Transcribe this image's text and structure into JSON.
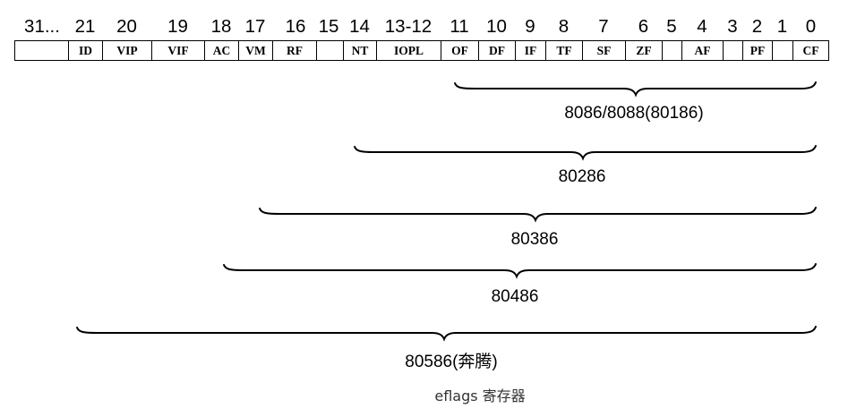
{
  "header_bits": [
    {
      "label": "31..."
    },
    {
      "label": "21"
    },
    {
      "label": "20"
    },
    {
      "label": "19"
    },
    {
      "label": "18"
    },
    {
      "label": "17"
    },
    {
      "label": "16"
    },
    {
      "label": "15"
    },
    {
      "label": "14"
    },
    {
      "label": "13-12"
    },
    {
      "label": "11"
    },
    {
      "label": "10"
    },
    {
      "label": "9"
    },
    {
      "label": "8"
    },
    {
      "label": "7"
    },
    {
      "label": "6"
    },
    {
      "label": "5"
    },
    {
      "label": "4"
    },
    {
      "label": "3"
    },
    {
      "label": "2"
    },
    {
      "label": "1"
    },
    {
      "label": "0"
    }
  ],
  "fields": [
    {
      "label": ""
    },
    {
      "label": "ID"
    },
    {
      "label": "VIP"
    },
    {
      "label": "VIF"
    },
    {
      "label": "AC"
    },
    {
      "label": "VM"
    },
    {
      "label": "RF"
    },
    {
      "label": ""
    },
    {
      "label": "NT"
    },
    {
      "label": "IOPL"
    },
    {
      "label": "OF"
    },
    {
      "label": "DF"
    },
    {
      "label": "IF"
    },
    {
      "label": "TF"
    },
    {
      "label": "SF"
    },
    {
      "label": "ZF"
    },
    {
      "label": ""
    },
    {
      "label": "AF"
    },
    {
      "label": ""
    },
    {
      "label": "PF"
    },
    {
      "label": ""
    },
    {
      "label": "CF"
    }
  ],
  "coverage": [
    {
      "label": "8086/8088(80186)",
      "from_bit": "11",
      "to_bit": "0"
    },
    {
      "label": "80286",
      "from_bit": "14",
      "to_bit": "0"
    },
    {
      "label": "80386",
      "from_bit": "17",
      "to_bit": "0"
    },
    {
      "label": "80486",
      "from_bit": "18",
      "to_bit": "0"
    },
    {
      "label": "80586(奔腾)",
      "from_bit": "21",
      "to_bit": "0"
    }
  ],
  "caption": "eflags 寄存器"
}
